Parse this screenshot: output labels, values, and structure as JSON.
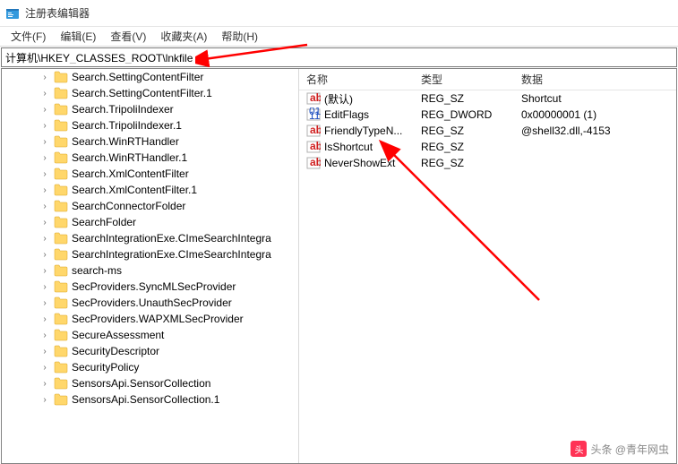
{
  "window": {
    "title": "注册表编辑器"
  },
  "menu": {
    "file": "文件(F)",
    "edit": "编辑(E)",
    "view": "查看(V)",
    "favorites": "收藏夹(A)",
    "help": "帮助(H)"
  },
  "address": {
    "path": "计算机\\HKEY_CLASSES_ROOT\\lnkfile"
  },
  "tree": {
    "items": [
      "Search.SettingContentFilter",
      "Search.SettingContentFilter.1",
      "Search.TripoliIndexer",
      "Search.TripoliIndexer.1",
      "Search.WinRTHandler",
      "Search.WinRTHandler.1",
      "Search.XmlContentFilter",
      "Search.XmlContentFilter.1",
      "SearchConnectorFolder",
      "SearchFolder",
      "SearchIntegrationExe.CImeSearchIntegra",
      "SearchIntegrationExe.CImeSearchIntegra",
      "search-ms",
      "SecProviders.SyncMLSecProvider",
      "SecProviders.UnauthSecProvider",
      "SecProviders.WAPXMLSecProvider",
      "SecureAssessment",
      "SecurityDescriptor",
      "SecurityPolicy",
      "SensorsApi.SensorCollection",
      "SensorsApi.SensorCollection.1"
    ]
  },
  "list": {
    "headers": {
      "name": "名称",
      "type": "类型",
      "data": "数据"
    },
    "rows": [
      {
        "icon": "string",
        "name": "(默认)",
        "type": "REG_SZ",
        "data": "Shortcut"
      },
      {
        "icon": "binary",
        "name": "EditFlags",
        "type": "REG_DWORD",
        "data": "0x00000001 (1)"
      },
      {
        "icon": "string",
        "name": "FriendlyTypeN...",
        "type": "REG_SZ",
        "data": "@shell32.dll,-4153"
      },
      {
        "icon": "string",
        "name": "IsShortcut",
        "type": "REG_SZ",
        "data": ""
      },
      {
        "icon": "string",
        "name": "NeverShowExt",
        "type": "REG_SZ",
        "data": ""
      }
    ]
  },
  "watermark": {
    "text": "头条 @青年网虫"
  }
}
